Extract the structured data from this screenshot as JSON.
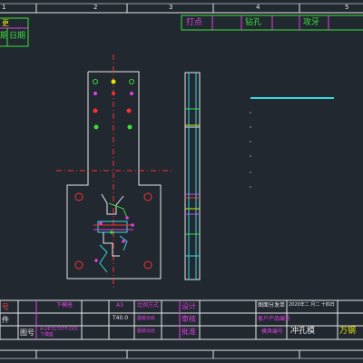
{
  "ruler": {
    "ticks": [
      "1",
      "2",
      "3",
      "4",
      "5"
    ]
  },
  "top_left": {
    "cell_1": "更",
    "cell_2": "期",
    "cell_3": "日期"
  },
  "process_header": {
    "punch_label": "打点",
    "drill_label": "钻孔",
    "tap_label": "攻牙"
  },
  "title_block": {
    "rows_left": [
      "号",
      "件",
      "图号"
    ],
    "part_name": "下模座",
    "drawing_no": "A:UP3170TF-D01",
    "drawing_no_sub": "下模座",
    "scale_label": "A3",
    "material": "T40.0",
    "qty_label": "比例方式",
    "qty_value": "图纸出处",
    "hardness": "图纸出处",
    "design_label": "设计",
    "review_label": "审核",
    "approve_label": "批准",
    "company_a": "图面分发单",
    "company_b": "客户产品编号",
    "company_c": "模具编号",
    "date_text": "2020年二 月二 十四日",
    "mold_name": "冲孔模",
    "brand": "万钢"
  },
  "colors": {
    "background": "#212830",
    "outline": "#e8e8e8",
    "magenta": "#e040e0",
    "green": "#3adf3a",
    "red": "#ff3030",
    "yellow": "#e6e600",
    "cyan": "#3ad7e0"
  }
}
